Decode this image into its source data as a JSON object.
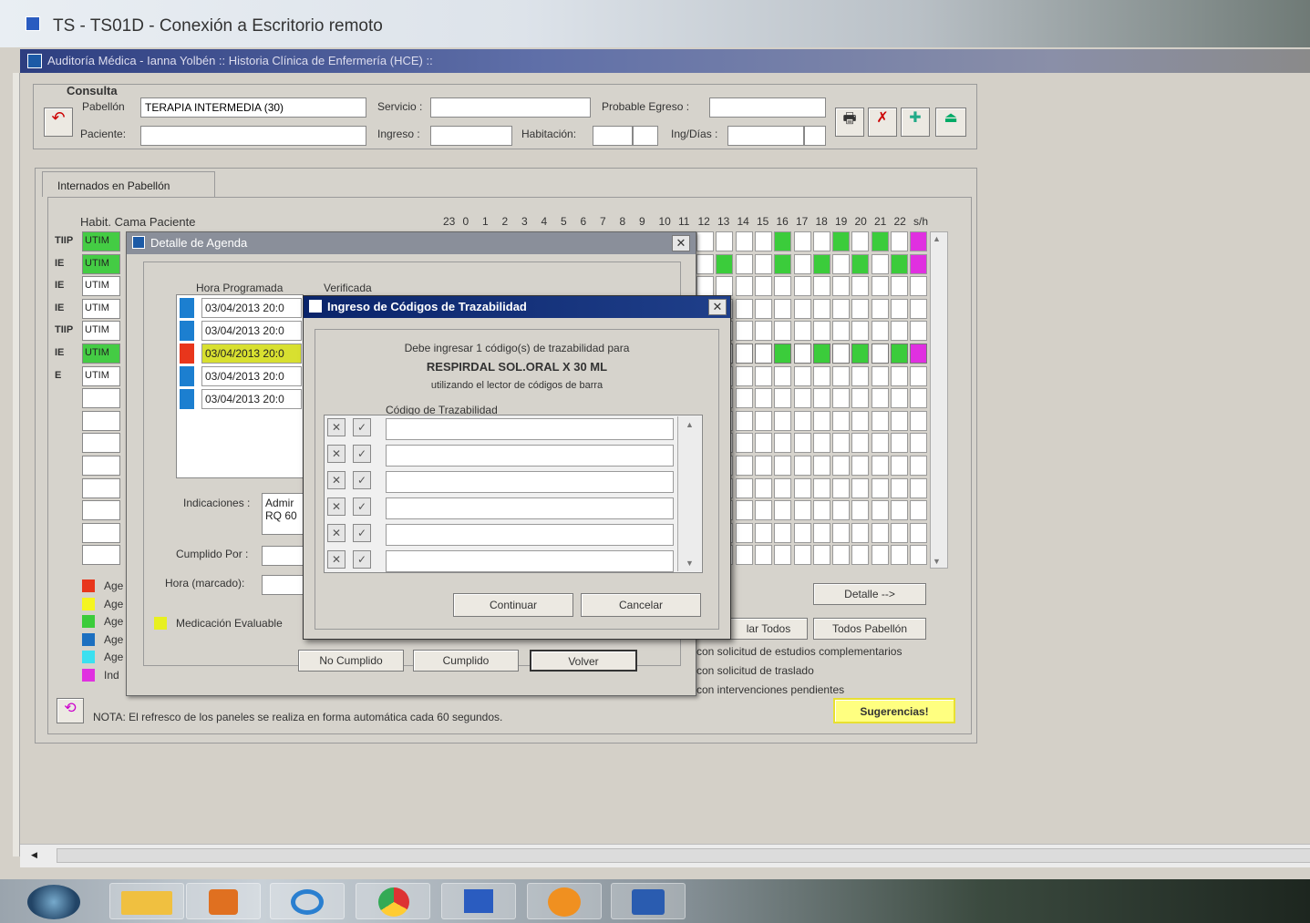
{
  "rdp": {
    "title": "TS - TS01D - Conexión a Escritorio remoto"
  },
  "app": {
    "title": "Auditoría Médica - Ianna Yolbén :: Historia Clínica de Enfermería (HCE) :: "
  },
  "consulta": {
    "heading": "Consulta",
    "pabellon_label": "Pabellón",
    "pabellon_value": "TERAPIA INTERMEDIA (30)",
    "paciente_label": "Paciente:",
    "paciente_value": "",
    "servicio_label": "Servicio :",
    "servicio_value": "",
    "ingreso_label": "Ingreso :",
    "ingreso_value": "",
    "habitacion_label": "Habitación:",
    "probable_label": "Probable Egreso :",
    "probable_value": "",
    "ingdias_label": "Ing/Días :"
  },
  "tabs": [
    {
      "label": "Internados en Pabellón"
    }
  ],
  "grid": {
    "header": "Habit. Cama Paciente",
    "hours": [
      "23",
      "0",
      "1",
      "2",
      "3",
      "4",
      "5",
      "6",
      "7",
      "8",
      "9",
      "10",
      "11",
      "12",
      "13",
      "14",
      "15",
      "16",
      "17",
      "18",
      "19",
      "20",
      "21",
      "22",
      "s/h"
    ],
    "rows": [
      {
        "code": "TIIP",
        "cama": "UTIM",
        "color": "#44cc44"
      },
      {
        "code": "IE",
        "cama": "UTIM",
        "color": "#44cc44"
      },
      {
        "code": "IE",
        "cama": "UTIM",
        "color": "#ffffff"
      },
      {
        "code": "IE",
        "cama": "UTIM",
        "color": "#ffffff"
      },
      {
        "code": "TIIP",
        "cama": "UTIM",
        "color": "#ffffff"
      },
      {
        "code": "IE",
        "cama": "UTIM",
        "color": "#44cc44"
      },
      {
        "code": "E",
        "cama": "UTIM",
        "color": "#ffffff"
      }
    ]
  },
  "legend": [
    "Age",
    "Age",
    "Age",
    "Age",
    "Age",
    "Ind"
  ],
  "legend_colors": [
    "#e8361c",
    "#f5f520",
    "#3bcc3b",
    "#1c6fc0",
    "#3be0f0",
    "#e030e0"
  ],
  "agenda_dialog": {
    "title": "Detalle de Agenda",
    "col_hora": "Hora Programada",
    "col_verificada": "Verificada",
    "rows": [
      "03/04/2013 20:0",
      "03/04/2013 20:0",
      "03/04/2013 20:0",
      "03/04/2013 20:0",
      "03/04/2013 20:0"
    ],
    "row_colors": [
      "#1c7fd0",
      "#1c7fd0",
      "#e8361c",
      "#1c7fd0",
      "#1c7fd0"
    ],
    "indicaciones_label": "Indicaciones :",
    "indicaciones_value": "Admir RQ 60",
    "cumplido_label": "Cumplido Por :",
    "hora_marcado_label": "Hora (marcado):",
    "medicacion_label": "Medicación Evaluable",
    "btn_no_cumplido": "No Cumplido",
    "btn_cumplido": "Cumplido",
    "btn_volver": "Volver"
  },
  "traz_dialog": {
    "title": "Ingreso de Códigos de Trazabilidad",
    "msg1": "Debe ingresar 1 código(s) de trazabilidad para",
    "product": "RESPIRDAL SOL.ORAL X 30 ML",
    "msg2": "utilizando el lector de códigos de barra",
    "col_label": "Código de Trazabilidad",
    "btn_continuar": "Continuar",
    "btn_cancelar": "Cancelar"
  },
  "right_buttons": {
    "detalle": "Detalle -->",
    "todos": "lar Todos",
    "todos_pabellon": "Todos Pabellón",
    "sugerencias": "Sugerencias!"
  },
  "notes": [
    "con solicitud de estudios complementarios",
    "con solicitud de traslado",
    "con intervenciones pendientes"
  ],
  "footer_note": "NOTA: El refresco de los paneles se realiza en forma automática cada 60 segundos.",
  "taskbar": [
    "start",
    "explorer",
    "media",
    "ie",
    "chrome",
    "remote",
    "app",
    "word"
  ]
}
